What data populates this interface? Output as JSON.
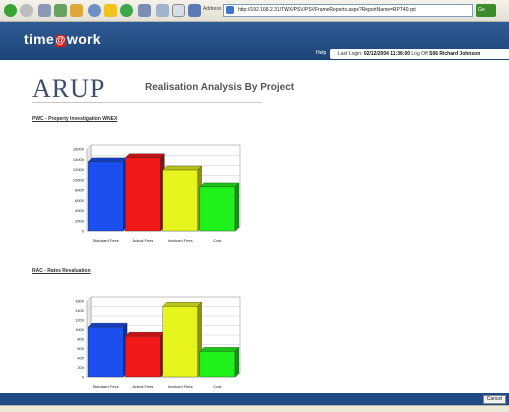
{
  "browser": {
    "address_label": "Address",
    "url": "http://192.168.2.31/TWX/PSV/PSVFrameReports.aspx?ReportName=RPT40.rpt",
    "go_label": "Go"
  },
  "header": {
    "logo_left": "time",
    "logo_ring": "@",
    "logo_right": "work",
    "help_label": "Help",
    "login_prefix": "Last Login:",
    "login_datetime": "02/12/2004  11:36:00",
    "logoff_label": "Log Off",
    "user_code": "S06",
    "user_name": "Richard Johnson"
  },
  "report": {
    "company": "ARUP",
    "title": "Realisation Analysis By Project"
  },
  "footer": {
    "cancel_label": "Cancel"
  },
  "chart_data": [
    {
      "type": "bar",
      "title": "PWC - Property Investigation WNEX",
      "categories": [
        "Standard Fees",
        "Actual Fees",
        "Invoiced Fees",
        "Cost"
      ],
      "values": [
        13500,
        14300,
        11900,
        8600
      ],
      "colors": [
        "#1c4ff0",
        "#f21818",
        "#e6f51b",
        "#1ff21a"
      ],
      "ylim": [
        0,
        16000
      ],
      "yticks": [
        "0",
        "2000",
        "4000",
        "6000",
        "8000",
        "10000",
        "12000",
        "14000",
        "16000"
      ],
      "grid": true,
      "style": "3d"
    },
    {
      "type": "bar",
      "title": "RAC - Rates Revaluation",
      "categories": [
        "Standard Fees",
        "Actual Fees",
        "Invoiced Fees",
        "Cost"
      ],
      "values": [
        1050,
        860,
        1490,
        540
      ],
      "colors": [
        "#1c4ff0",
        "#f21818",
        "#e6f51b",
        "#1ff21a"
      ],
      "ylim": [
        0,
        1600
      ],
      "yticks": [
        "0",
        "200",
        "400",
        "600",
        "800",
        "1000",
        "1200",
        "1400",
        "1600"
      ],
      "grid": true,
      "style": "3d"
    }
  ]
}
